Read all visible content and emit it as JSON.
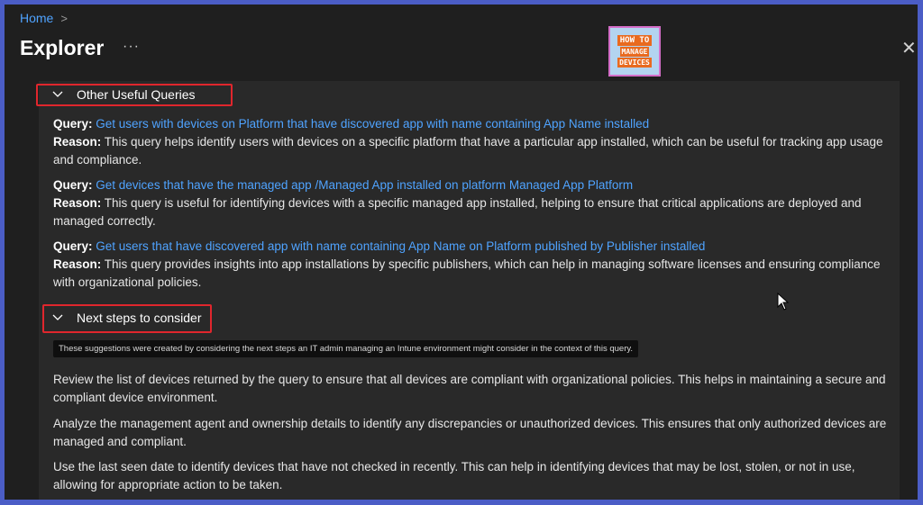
{
  "breadcrumb": {
    "home": "Home",
    "sep": ">"
  },
  "header": {
    "title": "Explorer",
    "more": "···",
    "close": "✕"
  },
  "logo": {
    "line1": "HOW TO",
    "line2": "MANAGE",
    "line3": "DEVICES"
  },
  "sections": {
    "other": {
      "title": "Other Useful Queries"
    },
    "next": {
      "title": "Next steps to consider"
    }
  },
  "queries": [
    {
      "query_label": "Query:",
      "query": "Get users with devices on Platform that have discovered app with name containing App Name installed",
      "reason_label": "Reason:",
      "reason": "This query helps identify users with devices on a specific platform that have a particular app installed, which can be useful for tracking app usage and compliance."
    },
    {
      "query_label": "Query:",
      "query": "Get devices that have the managed app /Managed App installed on platform Managed App Platform",
      "reason_label": "Reason:",
      "reason": "This query is useful for identifying devices with a specific managed app installed, helping to ensure that critical applications are deployed and managed correctly."
    },
    {
      "query_label": "Query:",
      "query": "Get users that have discovered app with name containing App Name on Platform published by Publisher installed",
      "reason_label": "Reason:",
      "reason": "This query provides insights into app installations by specific publishers, which can help in managing software licenses and ensuring compliance with organizational policies."
    }
  ],
  "tooltip": "These suggestions were created by considering the next steps an IT admin managing an Intune environment might consider in the context of this query.",
  "next_steps": [
    "Review the list of devices returned by the query to ensure that all devices are compliant with organizational policies. This helps in maintaining a secure and compliant device environment.",
    "Analyze the management agent and ownership details to identify any discrepancies or unauthorized devices. This ensures that only authorized devices are managed and compliant.",
    "Use the last seen date to identify devices that have not checked in recently. This can help in identifying devices that may be lost, stolen, or not in use, allowing for appropriate action to be taken."
  ],
  "colors": {
    "accent": "#4fa3ff",
    "highlight": "#e0262d",
    "background": "#1f1f1f"
  }
}
